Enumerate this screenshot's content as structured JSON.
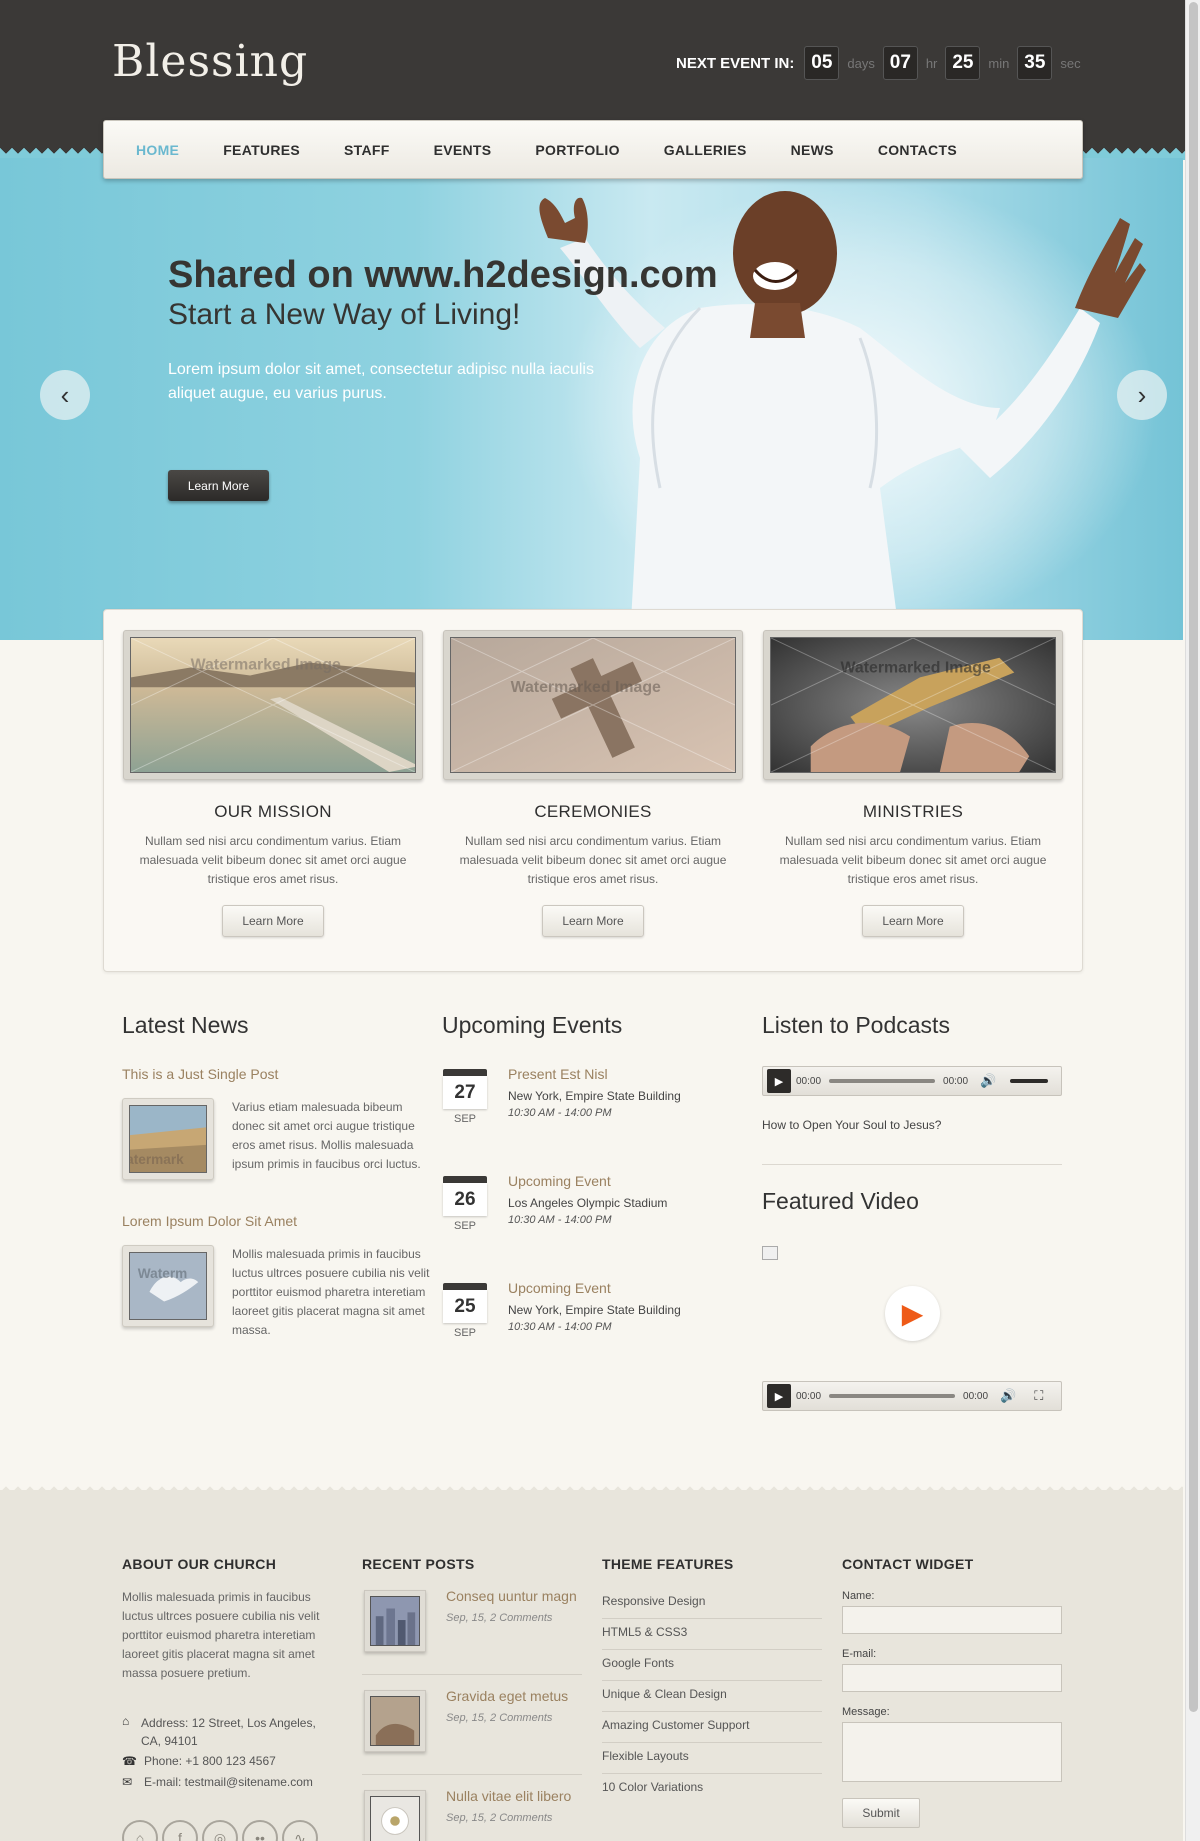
{
  "header": {
    "logo": "Blessing",
    "countdown": {
      "label": "NEXT EVENT IN:",
      "days": "05",
      "days_unit": "days",
      "hours": "07",
      "hours_unit": "hr",
      "minutes": "25",
      "minutes_unit": "min",
      "seconds": "35",
      "seconds_unit": "sec"
    }
  },
  "nav": {
    "items": [
      "HOME",
      "FEATURES",
      "STAFF",
      "EVENTS",
      "PORTFOLIO",
      "GALLERIES",
      "NEWS",
      "CONTACTS"
    ],
    "active": "HOME",
    "accent": "#6ab8cf"
  },
  "hero": {
    "title": "Shared on www.h2design.com",
    "subtitle": "Start a New Way of Living!",
    "text": "Lorem ipsum dolor sit amet, consectetur adipisc nulla iaculis aliquet augue, eu varius purus.",
    "button": "Learn More",
    "prev_icon": "chevron-left-icon",
    "next_icon": "chevron-right-icon"
  },
  "features": [
    {
      "title": "OUR MISSION",
      "text": "Nullam sed nisi arcu condimentum varius. Etiam malesuada velit bibeum donec sit amet orci augue tristique eros amet risus.",
      "button": "Learn More",
      "watermark": "Watermarked Image"
    },
    {
      "title": "CEREMONIES",
      "text": "Nullam sed nisi arcu condimentum varius. Etiam malesuada velit bibeum donec sit amet orci augue tristique eros amet risus.",
      "button": "Learn More",
      "watermark": "Watermarked Image"
    },
    {
      "title": "MINISTRIES",
      "text": "Nullam sed nisi arcu condimentum varius. Etiam malesuada velit bibeum donec sit amet orci augue tristique eros amet risus.",
      "button": "Learn More",
      "watermark": "Watermarked Image"
    }
  ],
  "latest_news": {
    "title": "Latest News",
    "posts": [
      {
        "title": "This is a Just Single Post",
        "text": "Varius etiam malesuada bibeum donec sit amet orci augue tristique eros amet risus. Mollis malesuada ipsum primis in faucibus orci luctus.",
        "watermark": "atermark"
      },
      {
        "title": "Lorem Ipsum Dolor Sit Amet",
        "text": "Mollis malesuada primis in faucibus luctus ultrces posuere cubilia nis velit porttitor euismod pharetra interetiam laoreet gitis placerat magna sit amet massa.",
        "watermark": "Waterm"
      }
    ]
  },
  "upcoming_events": {
    "title": "Upcoming Events",
    "events": [
      {
        "day": "27",
        "month": "SEP",
        "title": "Present Est Nisl",
        "place": "New York, Empire State Building",
        "time": "10:30 AM - 14:00 PM"
      },
      {
        "day": "26",
        "month": "SEP",
        "title": "Upcoming Event",
        "place": "Los Angeles Olympic Stadium",
        "time": "10:30 AM - 14:00 PM"
      },
      {
        "day": "25",
        "month": "SEP",
        "title": "Upcoming Event",
        "place": "New York, Empire State Building",
        "time": "10:30 AM - 14:00 PM"
      }
    ]
  },
  "podcasts": {
    "title": "Listen to Podcasts",
    "time_start": "00:00",
    "time_end": "00:00",
    "caption": "How to Open Your Soul to Jesus?"
  },
  "featured_video": {
    "title": "Featured Video",
    "time_start": "00:00",
    "time_end": "00:00",
    "play_color": "#ee5a17"
  },
  "footer": {
    "about": {
      "title": "ABOUT OUR CHURCH",
      "text": "Mollis malesuada primis in faucibus luctus ultrces posuere cubilia nis velit porttitor euismod pharetra interetiam laoreet gitis placerat magna sit amet massa posuere pretium.",
      "address": "Address: 12 Street, Los Angeles, CA, 94101",
      "phone": "Phone: +1 800 123 4567",
      "email": "E-mail: testmail@sitename.com"
    },
    "recent_posts": {
      "title": "RECENT POSTS",
      "posts": [
        {
          "title": "Conseq uuntur magn",
          "meta": "Sep, 15, 2 Comments"
        },
        {
          "title": "Gravida eget metus",
          "meta": "Sep, 15, 2 Comments"
        },
        {
          "title": "Nulla vitae elit libero",
          "meta": "Sep, 15, 2 Comments"
        }
      ]
    },
    "theme_features": {
      "title": "THEME FEATURES",
      "items": [
        "Responsive Design",
        "HTML5 & CSS3",
        "Google Fonts",
        "Unique & Clean Design",
        "Amazing Customer Support",
        "Flexible Layouts",
        "10 Color Variations"
      ]
    },
    "contact_widget": {
      "title": "CONTACT WIDGET",
      "name_label": "Name:",
      "email_label": "E-mail:",
      "message_label": "Message:",
      "submit": "Submit"
    }
  }
}
